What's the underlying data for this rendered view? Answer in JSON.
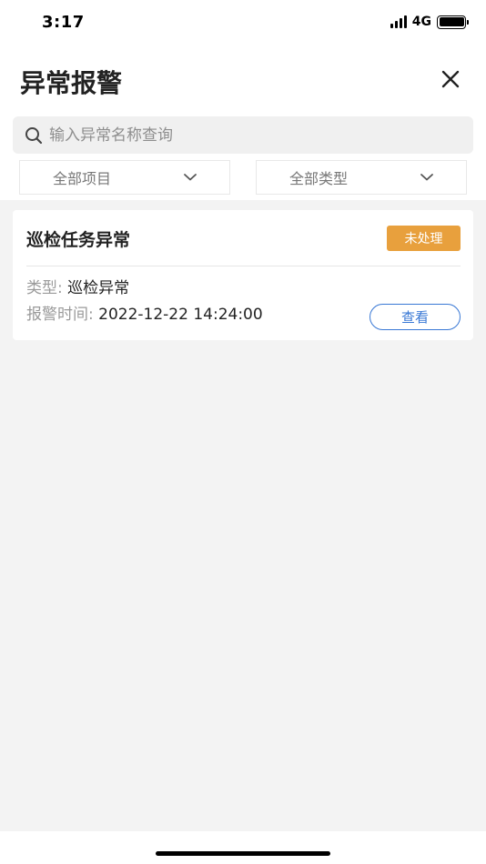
{
  "status_bar": {
    "time": "3:17",
    "network": "4G"
  },
  "header": {
    "title": "异常报警",
    "close_icon": "close-icon"
  },
  "search": {
    "placeholder": "输入异常名称查询",
    "value": "",
    "icon": "search-icon"
  },
  "filters": [
    {
      "label": "全部项目",
      "icon": "chevron-down-icon"
    },
    {
      "label": "全部类型",
      "icon": "chevron-down-icon"
    }
  ],
  "alerts": [
    {
      "title": "巡检任务异常",
      "status": "未处理",
      "type_label": "类型:",
      "type_value": "巡检异常",
      "time_label": "报警时间:",
      "time_value": "2022-12-22 14:24:00",
      "action_label": "查看"
    }
  ],
  "colors": {
    "accent": "#3978d5",
    "status_pending": "#e8a03d",
    "background": "#f3f3f3"
  }
}
